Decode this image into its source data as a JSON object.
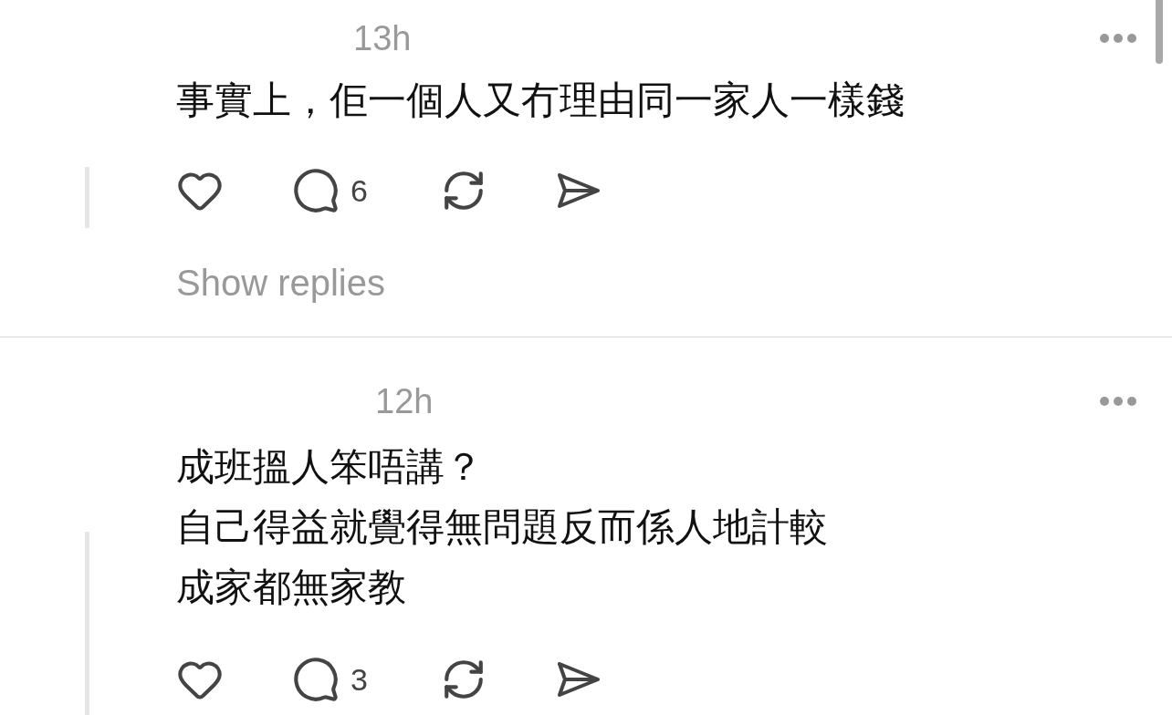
{
  "posts": [
    {
      "time": "13h",
      "lines": [
        "事實上，佢一個人又冇理由同一家人一樣錢"
      ],
      "reply_count": "6",
      "show_replies": "Show replies"
    },
    {
      "time": "12h",
      "lines": [
        "成班搵人笨唔講？",
        "自己得益就覺得無問題反而係人地計較",
        "成家都無家教"
      ],
      "reply_count": "3"
    }
  ]
}
